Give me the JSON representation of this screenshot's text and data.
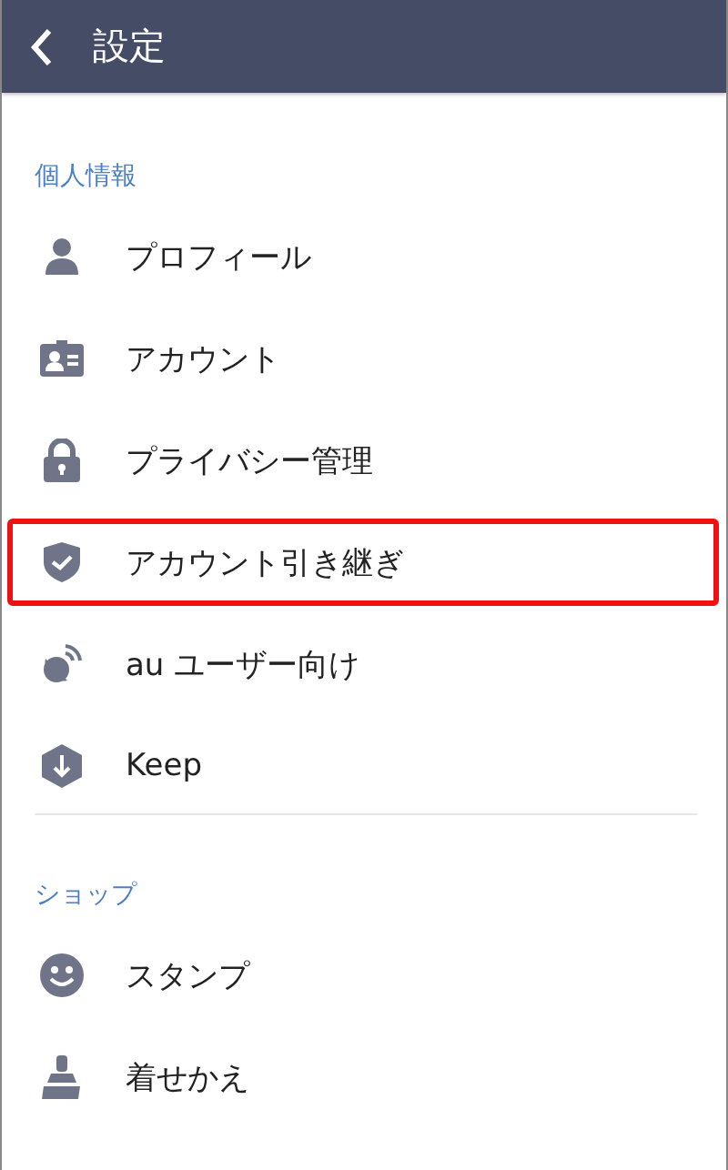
{
  "header": {
    "title": "設定"
  },
  "sections": [
    {
      "title": "個人情報",
      "items": [
        {
          "label": "プロフィール",
          "highlighted": false
        },
        {
          "label": "アカウント",
          "highlighted": false
        },
        {
          "label": "プライバシー管理",
          "highlighted": false
        },
        {
          "label": "アカウント引き継ぎ",
          "highlighted": true
        },
        {
          "label": "au ユーザー向け",
          "highlighted": false
        },
        {
          "label": "Keep",
          "highlighted": false
        }
      ]
    },
    {
      "title": "ショップ",
      "items": [
        {
          "label": "スタンプ",
          "highlighted": false
        },
        {
          "label": "着せかえ",
          "highlighted": false
        }
      ]
    }
  ]
}
